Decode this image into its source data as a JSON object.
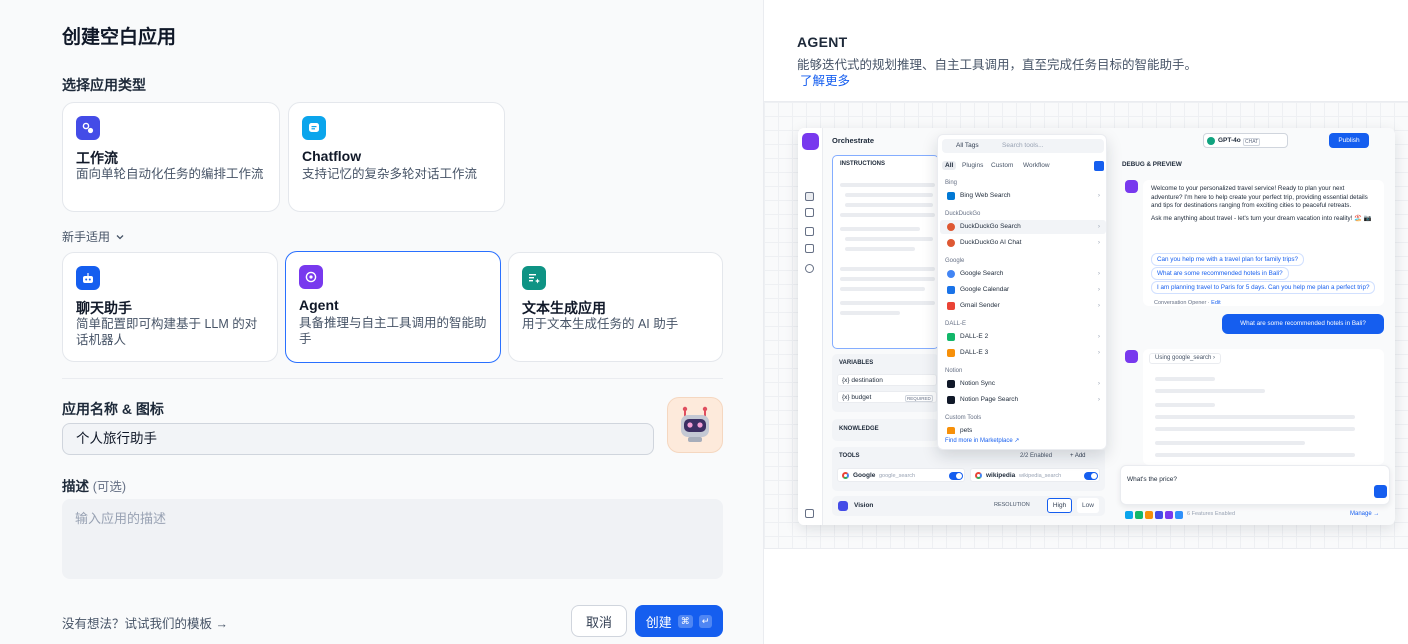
{
  "page_title": "创建空白应用",
  "section_app_type": "选择应用类型",
  "novice_label": "新手适用",
  "cards": [
    {
      "title": "工作流",
      "desc": "面向单轮自动化任务的编排工作流",
      "icon": "workflow-icon",
      "color": "#444ce7"
    },
    {
      "title": "Chatflow",
      "desc": "支持记忆的复杂多轮对话工作流",
      "icon": "chatflow-icon",
      "color": "#0ba5ec"
    },
    {
      "title": "聊天助手",
      "desc": "简单配置即可构建基于 LLM 的对话机器人",
      "icon": "chatbot-icon",
      "color": "#155eef"
    },
    {
      "title": "Agent",
      "desc": "具备推理与自主工具调用的智能助手",
      "icon": "agent-icon",
      "color": "#7839ee"
    },
    {
      "title": "文本生成应用",
      "desc": "用于文本生成任务的 AI 助手",
      "icon": "text-generator-icon",
      "color": "#0e9384"
    }
  ],
  "name_label": "应用名称 & 图标",
  "name_value": "个人旅行助手",
  "desc_label": "描述",
  "desc_optional": "(可选)",
  "desc_placeholder": "输入应用的描述",
  "template_link": "没有想法？试试我们的模板 →",
  "cancel_label": "取消",
  "create_label": "创建",
  "create_kbd": [
    "⌘",
    "↵"
  ],
  "preview": {
    "title": "AGENT",
    "desc": "能够迭代式的规划推理、自主工具调用，直至完成任务目标的智能助手。",
    "learn_more": "了解更多",
    "shot": {
      "orchestrate": "Orchestrate",
      "model": "GPT-4o",
      "model_tag": "CHAT",
      "publish": "Publish",
      "instructions": "INSTRUCTIONS",
      "variables": "VARIABLES",
      "vars": [
        {
          "name": "{x} destination",
          "tag": ""
        },
        {
          "name": "{x} budget",
          "tag": "REQUIRED"
        }
      ],
      "knowledge": "KNOWLEDGE",
      "tools": "TOOLS",
      "tools_enabled": "2/2 Enabled",
      "add": "+ Add",
      "tool_items": [
        {
          "name": "Google",
          "id": "google_search"
        },
        {
          "name": "wikipedia",
          "id": "wikipedia_search"
        }
      ],
      "vision": "Vision",
      "resolution": "RESOLUTION",
      "high": "High",
      "low": "Low",
      "popover": {
        "all_tags": "All Tags",
        "search_placeholder": "Search tools...",
        "tabs": [
          "All",
          "Plugins",
          "Custom",
          "Workflow"
        ],
        "groups": [
          {
            "name": "Bing",
            "items": [
              "Bing Web Search"
            ]
          },
          {
            "name": "DuckDuckGo",
            "items": [
              "DuckDuckGo Search",
              "DuckDuckGo AI Chat"
            ]
          },
          {
            "name": "Google",
            "items": [
              "Google Search",
              "Google Calendar",
              "Gmail Sender"
            ]
          },
          {
            "name": "DALL-E",
            "items": [
              "DALL-E 2",
              "DALL-E 3"
            ]
          },
          {
            "name": "Notion",
            "items": [
              "Notion Sync",
              "Notion Page Search"
            ]
          },
          {
            "name": "Custom Tools",
            "items": [
              "pets"
            ]
          }
        ],
        "find_more": "Find more in Marketplace ↗"
      },
      "debug": "DEBUG & PREVIEW",
      "welcome_p1": "Welcome to your personalized travel service! Ready to plan your next adventure? I'm here to help create your perfect trip, providing essential details and tips for destinations ranging from exciting cities to peaceful retreats.",
      "welcome_p2": "Ask me anything about travel - let's turn your dream vacation into reality! 🏖️ 📷",
      "suggestions": [
        "Can you help me with a travel plan for family trips?",
        "What are some recommended hotels in Bali?",
        "I am planning travel to Paris for 5 days. Can you help me plan a perfect trip?"
      ],
      "opener": "Conversation Opener",
      "opener_edit": "Edit",
      "user_msg": "What are some recommended hotels in Bali?",
      "using": "Using",
      "using_tool": "google_search",
      "input_text": "What's the price?",
      "features": "6 Features Enabled",
      "manage": "Manage →"
    }
  }
}
